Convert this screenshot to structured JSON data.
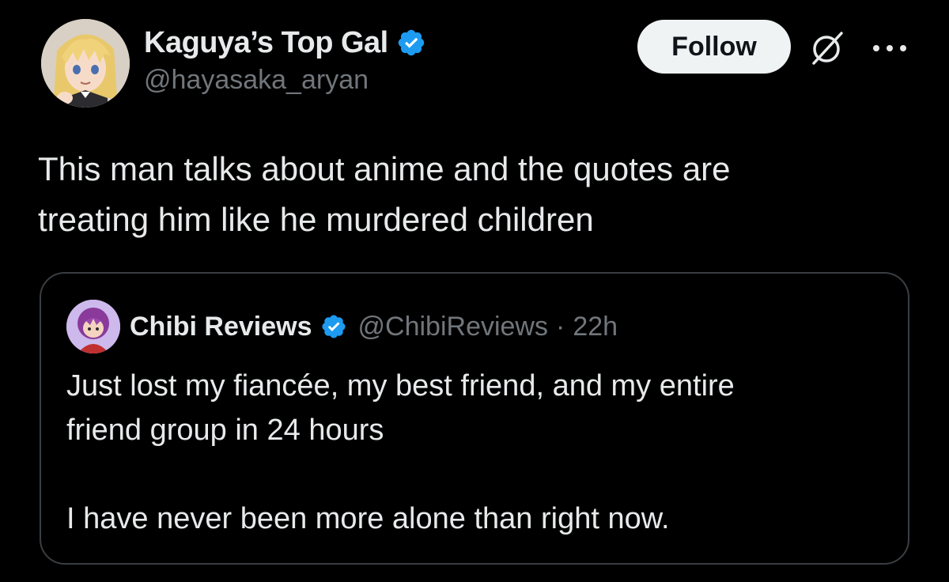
{
  "author": {
    "display_name": "Kaguya’s Top Gal",
    "handle": "@hayasaka_aryan",
    "verified_icon": "verified-badge-icon",
    "avatar": "anime-avatar"
  },
  "actions": {
    "follow_label": "Follow",
    "grok_icon": "grok-icon",
    "more_icon": "more-options-icon"
  },
  "tweet": {
    "text_line1": "This man talks about anime and the quotes are",
    "text_line2": "treating him like he murdered children"
  },
  "quoted": {
    "display_name": "Chibi Reviews",
    "handle": "@ChibiReviews",
    "separator": "·",
    "time": "22h",
    "text_line1": "Just lost my fiancée, my best friend, and my entire",
    "text_line2": "friend group in 24 hours",
    "text_line3": "I have never been more alone than right now."
  },
  "colors": {
    "background": "#000000",
    "text_primary": "#e7e9ea",
    "text_secondary": "#71767b",
    "verified_blue": "#1d9bf0",
    "border": "#3a3e42",
    "follow_bg": "#eff3f4"
  }
}
